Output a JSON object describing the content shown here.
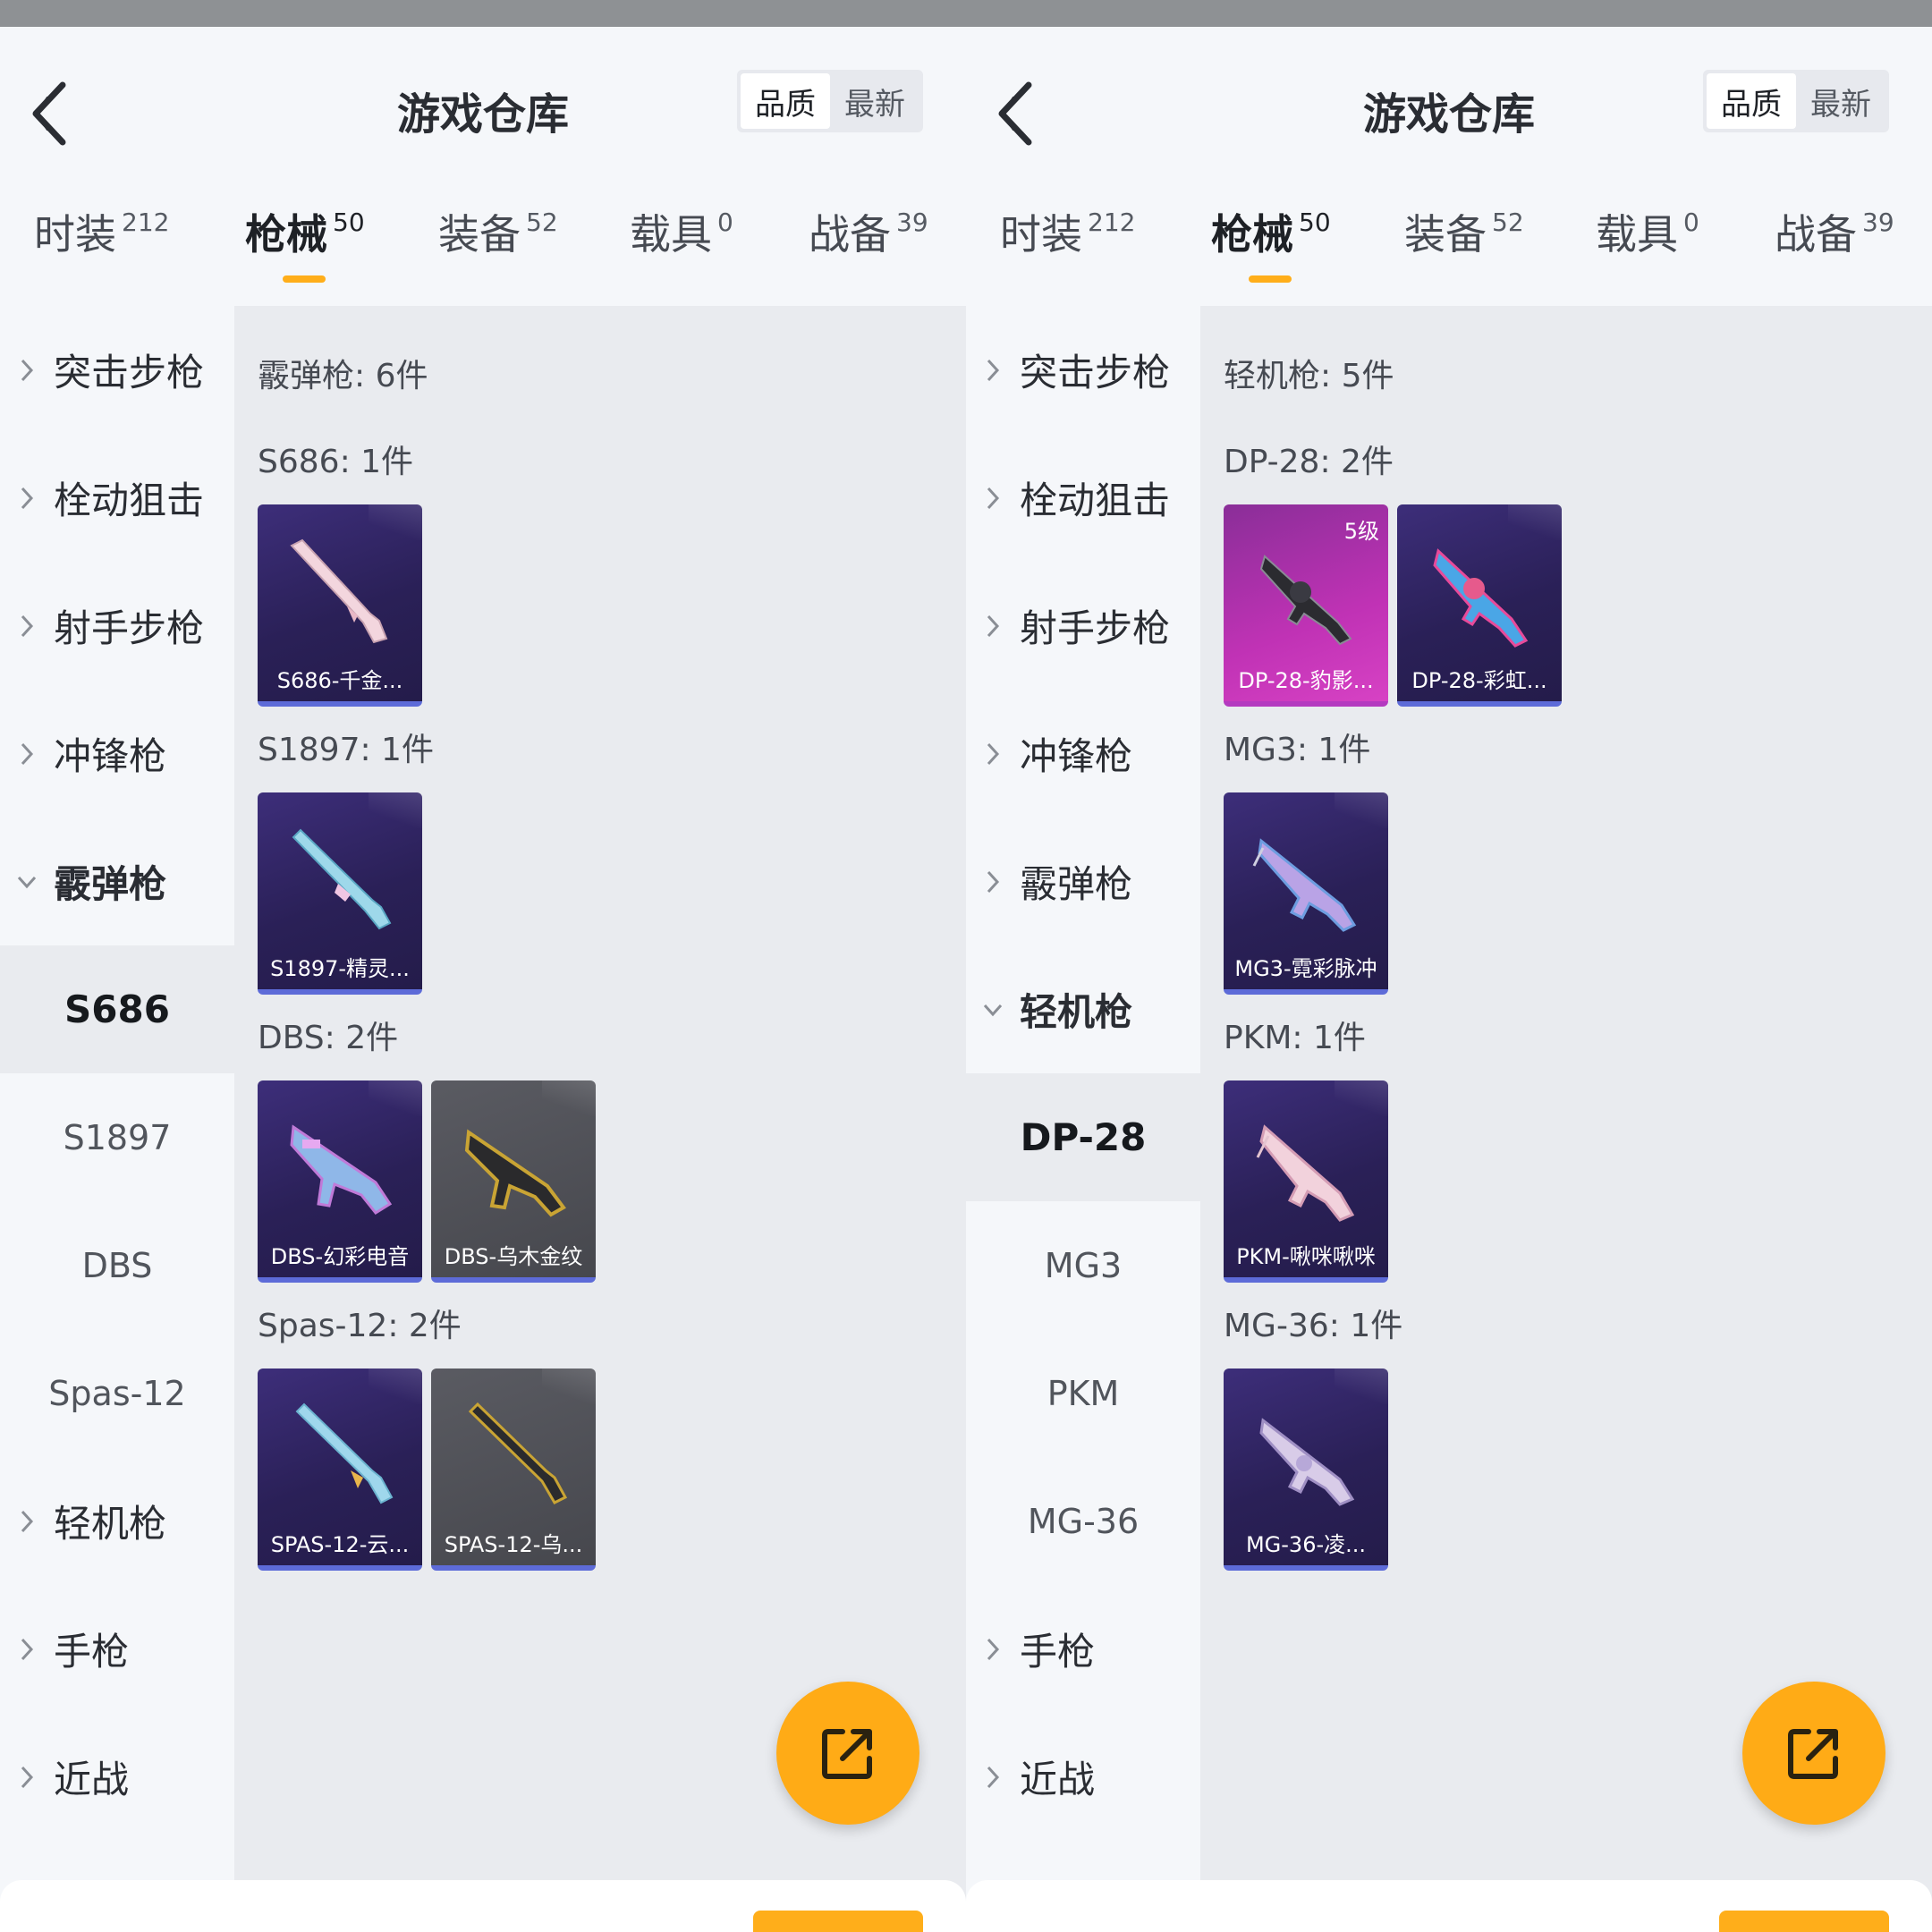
{
  "left": {
    "title": "游戏仓库",
    "sort": {
      "quality": "品质",
      "newest": "最新"
    },
    "tabs": [
      {
        "label": "时装",
        "count": "212"
      },
      {
        "label": "枪械",
        "count": "50"
      },
      {
        "label": "装备",
        "count": "52"
      },
      {
        "label": "载具",
        "count": "0"
      },
      {
        "label": "战备",
        "count": "39"
      }
    ],
    "sidebar": {
      "assault": "突击步枪",
      "bolt": "栓动狙击",
      "marksman": "射手步枪",
      "smg": "冲锋枪",
      "shotgun": "霰弹枪",
      "sub": [
        "S686",
        "S1897",
        "DBS",
        "Spas-12"
      ],
      "lmg": "轻机枪",
      "pistol": "手枪",
      "melee": "近战"
    },
    "content": {
      "summary": "霰弹枪: 6件",
      "groups": [
        {
          "header": "S686: 1件",
          "items": [
            "S686-千金..."
          ]
        },
        {
          "header": "S1897: 1件",
          "items": [
            "S1897-精灵..."
          ]
        },
        {
          "header": "DBS: 2件",
          "items": [
            "DBS-幻彩电音",
            "DBS-乌木金纹"
          ]
        },
        {
          "header": "Spas-12: 2件",
          "items": [
            "SPAS-12-云...",
            "SPAS-12-乌..."
          ]
        }
      ]
    }
  },
  "right": {
    "title": "游戏仓库",
    "sort": {
      "quality": "品质",
      "newest": "最新"
    },
    "tabs": [
      {
        "label": "时装",
        "count": "212"
      },
      {
        "label": "枪械",
        "count": "50"
      },
      {
        "label": "装备",
        "count": "52"
      },
      {
        "label": "载具",
        "count": "0"
      },
      {
        "label": "战备",
        "count": "39"
      }
    ],
    "sidebar": {
      "assault": "突击步枪",
      "bolt": "栓动狙击",
      "marksman": "射手步枪",
      "smg": "冲锋枪",
      "shotgun": "霰弹枪",
      "lmg": "轻机枪",
      "sub": [
        "DP-28",
        "MG3",
        "PKM",
        "MG-36"
      ],
      "pistol": "手枪",
      "melee": "近战"
    },
    "content": {
      "summary": "轻机枪: 5件",
      "groups": [
        {
          "header": "DP-28: 2件",
          "items": [
            "DP-28-豹影...",
            "DP-28-彩虹..."
          ],
          "level": "5级"
        },
        {
          "header": "MG3: 1件",
          "items": [
            "MG3-霓彩脉冲"
          ]
        },
        {
          "header": "PKM: 1件",
          "items": [
            "PKM-啾咪啾咪"
          ]
        },
        {
          "header": "MG-36: 1件",
          "items": [
            "MG-36-凌..."
          ]
        }
      ]
    }
  },
  "colors": {
    "accent": "#ffae1a",
    "rarity_purple": "#2a2057",
    "rarity_pink": "#c032b5",
    "rarity_grey": "#4f5056"
  },
  "icons": {
    "back": "chevron-left-icon",
    "share": "share-icon",
    "expand": "chevron-right-icon",
    "collapse": "chevron-down-icon"
  }
}
